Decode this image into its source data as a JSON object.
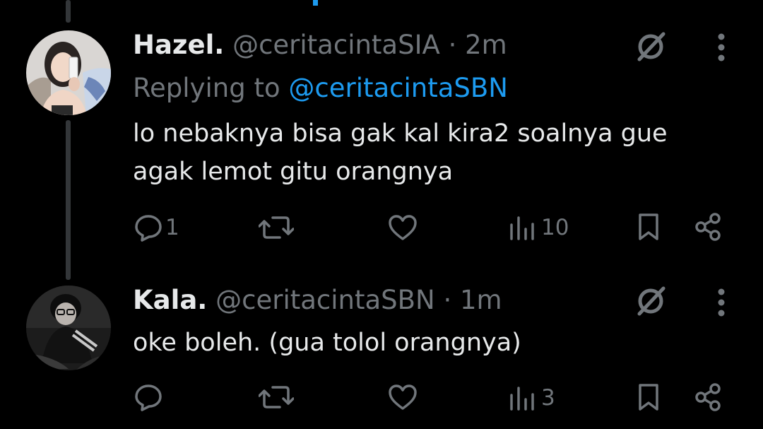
{
  "tweets": [
    {
      "display_name": "Hazel.",
      "handle": "@ceritacintaSIA",
      "separator": "·",
      "time": "2m",
      "replying_label": "Replying to",
      "replying_to": "@ceritacintaSBN",
      "text_line1": "lo nebaknya bisa gak kal kira2 soalnya gue",
      "text_line2": "agak lemot gitu orangnya",
      "reply_count": "1",
      "view_count": "10"
    },
    {
      "display_name": "Kala.",
      "handle": "@ceritacintaSBN",
      "separator": "·",
      "time": "1m",
      "text_line1": "oke boleh. (gua tolol orangnya)",
      "view_count": "3"
    }
  ],
  "colors": {
    "background": "#000000",
    "text": "#e7e9ea",
    "muted": "#71767b",
    "accent": "#1d9bf0",
    "thread_line": "#333639"
  },
  "icons": [
    "reply-icon",
    "retweet-icon",
    "like-icon",
    "views-icon",
    "bookmark-icon",
    "share-icon",
    "grok-icon",
    "more-icon"
  ]
}
